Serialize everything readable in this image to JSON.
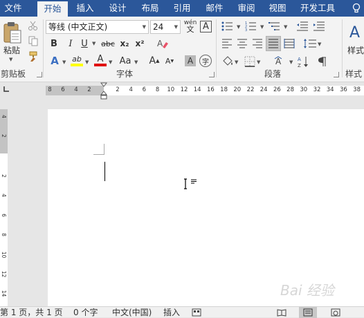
{
  "tabs": [
    "文件",
    "开始",
    "插入",
    "设计",
    "布局",
    "引用",
    "邮件",
    "审阅",
    "视图",
    "开发工具"
  ],
  "active_tab": "开始",
  "clipboard": {
    "paste_label": "粘贴",
    "group_label": "剪贴板"
  },
  "font": {
    "font_name": "等线 (中文正文)",
    "font_size": "24",
    "phonetic_label": "wén",
    "char_border_label": "A",
    "bold": "B",
    "italic": "I",
    "underline": "U",
    "strike": "abc",
    "subscript": "x₂",
    "superscript": "x²",
    "text_effect": "A",
    "highlight": "ab",
    "font_color": "A",
    "change_case": "Aa",
    "grow": "A",
    "shrink": "A",
    "char_shading": "A",
    "enclose": "字",
    "group_label": "字体"
  },
  "paragraph": {
    "group_label": "段落"
  },
  "styles": {
    "styles_label": "样式",
    "group_label": "样式"
  },
  "ruler": {
    "h_left": [
      "8",
      "6",
      "4",
      "2"
    ],
    "h_right": [
      "2",
      "4",
      "6",
      "8",
      "10",
      "12",
      "14",
      "16",
      "18",
      "20",
      "22",
      "24",
      "26",
      "28",
      "30",
      "32",
      "34",
      "36",
      "38"
    ],
    "v_top": [
      "4",
      "2"
    ],
    "v_body": [
      "2",
      "4",
      "6",
      "8",
      "10",
      "12",
      "14"
    ]
  },
  "status": {
    "page": "第 1 页，共 1 页",
    "words": "0 个字",
    "language": "中文(中国)",
    "insert_mode": "插入"
  },
  "watermark": "Bai 经验",
  "colors": {
    "ribbon_blue": "#2b579a",
    "highlight_yellow": "#ffff00",
    "font_red": "#e00000"
  }
}
